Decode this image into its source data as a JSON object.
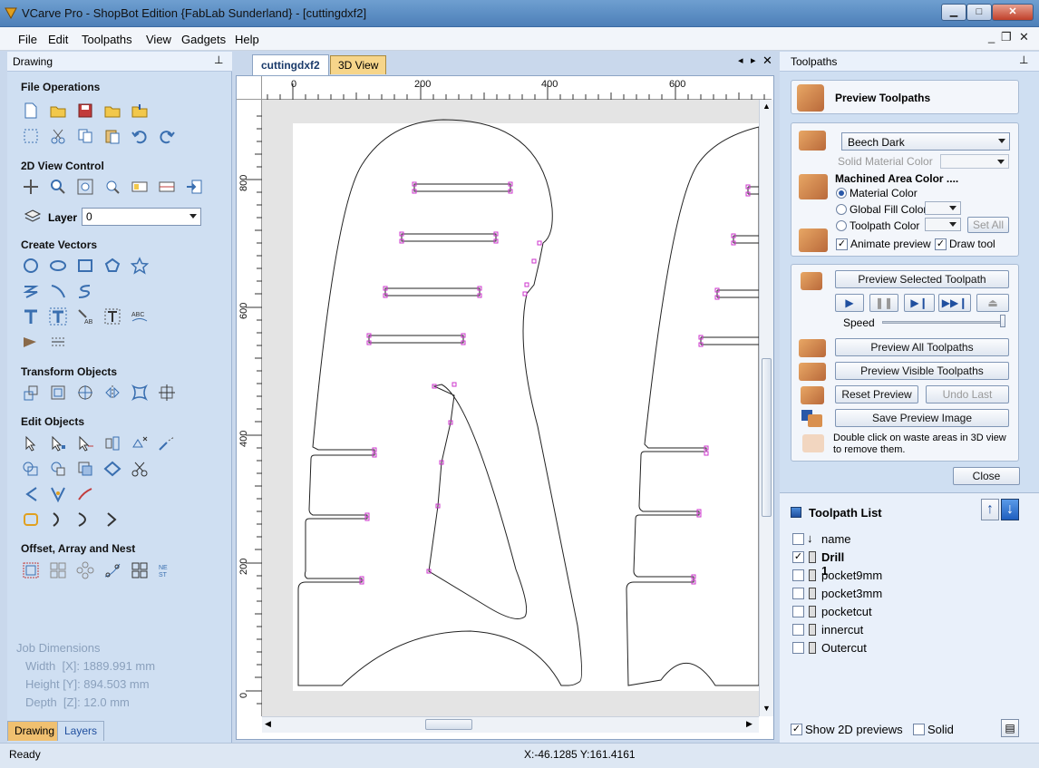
{
  "window": {
    "title": "VCarve Pro - ShopBot Edition {FabLab Sunderland} - [cuttingdxf2]",
    "buttons": {
      "minimize": "▁",
      "maximize": "□",
      "close": "✕"
    }
  },
  "menu": [
    "File",
    "Edit",
    "Toolpaths",
    "View",
    "Gadgets",
    "Help"
  ],
  "mdi_buttons": {
    "minimize": "_",
    "restore": "❐",
    "close": "✕"
  },
  "left_panel": {
    "title": "Drawing",
    "sections": {
      "file_ops": "File Operations",
      "view_control": "2D View Control",
      "create_vectors": "Create Vectors",
      "transform": "Transform Objects",
      "edit": "Edit Objects",
      "offset": "Offset, Array and Nest"
    },
    "layer_label": "Layer",
    "layer_value": "0",
    "job_dims": {
      "title": "Job Dimensions",
      "width": "Width  [X]: 1889.991 mm",
      "height": "Height [Y]: 894.503 mm",
      "depth": "Depth  [Z]: 12.0 mm"
    },
    "tabs": [
      "Drawing",
      "Layers"
    ]
  },
  "document": {
    "tabs": [
      "cuttingdxf2",
      "3D View"
    ],
    "ruler_h": [
      "0",
      "200",
      "400",
      "600"
    ],
    "ruler_v": [
      "800",
      "600",
      "400",
      "200",
      "0"
    ]
  },
  "right_panel": {
    "title": "Toolpaths",
    "heading": "Preview Toolpaths",
    "material": "Beech Dark",
    "solid_material_color": "Solid Material Color",
    "machined_area_title": "Machined Area Color ....",
    "radio_material": "Material Color",
    "radio_global": "Global Fill Color",
    "radio_toolpath": "Toolpath Color",
    "set_all": "Set All",
    "animate_preview": "Animate preview",
    "draw_tool": "Draw tool",
    "preview_selected": "Preview Selected Toolpath",
    "speed": "Speed",
    "preview_all": "Preview All Toolpaths",
    "preview_visible": "Preview Visible Toolpaths",
    "reset_preview": "Reset Preview",
    "undo_last": "Undo Last",
    "save_image": "Save Preview Image",
    "hint": "Double click on waste areas in 3D view to remove them.",
    "close": "Close",
    "toolpath_list_title": "Toolpath List",
    "toolpaths": [
      {
        "name": "name",
        "checked": false,
        "bold": false
      },
      {
        "name": "Drill 1",
        "checked": true,
        "bold": true
      },
      {
        "name": "pocket9mm",
        "checked": false,
        "bold": false
      },
      {
        "name": "pocket3mm",
        "checked": false,
        "bold": false
      },
      {
        "name": "pocketcut",
        "checked": false,
        "bold": false
      },
      {
        "name": "innercut",
        "checked": false,
        "bold": false
      },
      {
        "name": "Outercut",
        "checked": false,
        "bold": false
      }
    ],
    "show_2d": "Show 2D previews",
    "solid": "Solid"
  },
  "status": {
    "left": "Ready",
    "coords": "X:-46.1285 Y:161.4161"
  },
  "colors": {
    "accent": "#2a58a8",
    "node": "#cc33cc",
    "panel": "#cfdff2"
  }
}
